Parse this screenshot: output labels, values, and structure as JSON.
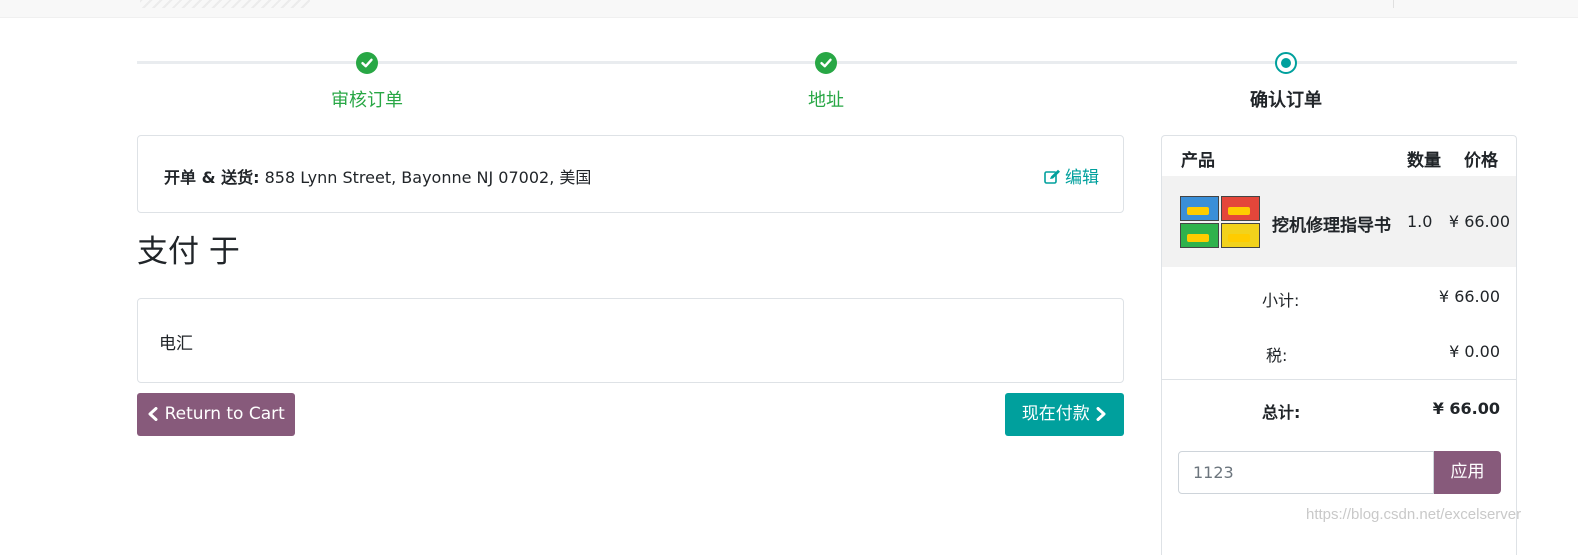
{
  "steps": [
    {
      "label": "审核订单",
      "status": "done"
    },
    {
      "label": "地址",
      "status": "done"
    },
    {
      "label": "确认订单",
      "status": "current"
    }
  ],
  "address": {
    "label": "开单 & 送货:",
    "value": " 858 Lynn Street, Bayonne NJ 07002, 美国",
    "edit_label": "编辑"
  },
  "payment": {
    "title": "支付 于",
    "method": "电汇"
  },
  "buttons": {
    "back_label": "Return to Cart",
    "pay_label": "现在付款"
  },
  "summary": {
    "headers": {
      "product": "产品",
      "qty": "数量",
      "price": "价格"
    },
    "item": {
      "name": "挖机修理指导书",
      "qty": "1.0",
      "price": "¥ 66.00"
    },
    "subtotal_label": "小计:",
    "subtotal_value": "¥ 66.00",
    "tax_label": "税:",
    "tax_value": "¥ 0.00",
    "total_label": "总计:",
    "total_value": "¥ 66.00",
    "coupon_value": "1123",
    "coupon_button": "应用"
  },
  "watermark": "https://blog.csdn.net/excelserver",
  "colors": {
    "done": "#28a745",
    "accent": "#00a09d",
    "primary": "#875a7b"
  }
}
